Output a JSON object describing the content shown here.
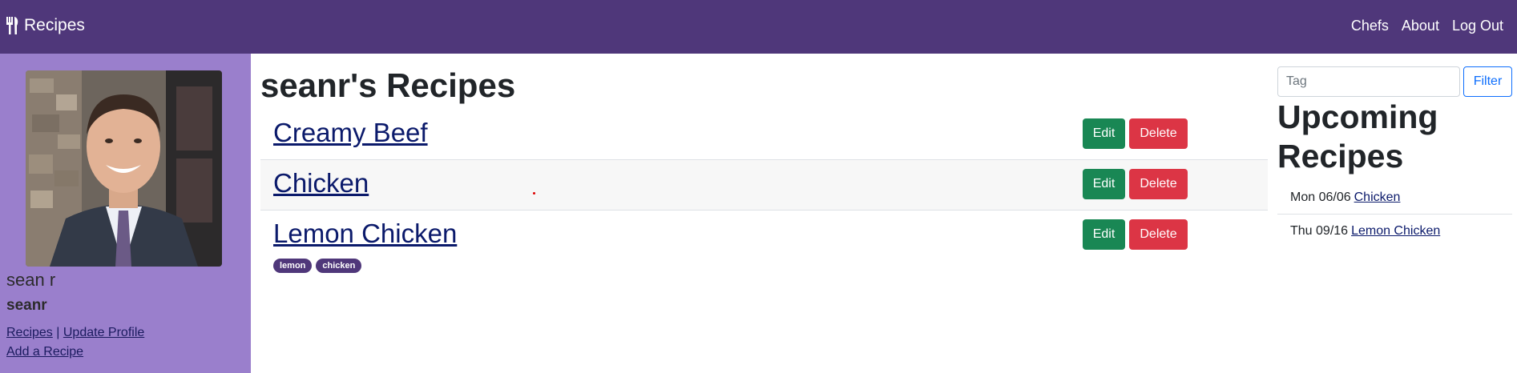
{
  "nav": {
    "brand": "Recipes",
    "links": [
      "Chefs",
      "About",
      "Log Out"
    ]
  },
  "profile": {
    "full_name": "sean r",
    "username": "seanr",
    "link_recipes": "Recipes",
    "separator": "|",
    "link_update_profile": "Update Profile",
    "link_add_recipe": "Add a Recipe"
  },
  "main": {
    "title": "seanr's Recipes",
    "recipes": [
      {
        "title": "Creamy Beef",
        "tags": []
      },
      {
        "title": "Chicken",
        "tags": []
      },
      {
        "title": "Lemon Chicken",
        "tags": [
          "lemon",
          "chicken"
        ]
      }
    ],
    "edit_label": "Edit",
    "delete_label": "Delete"
  },
  "sidebar_right": {
    "tag_placeholder": "Tag",
    "filter_label": "Filter",
    "upcoming_title": "Upcoming Recipes",
    "upcoming": [
      {
        "date": "Mon 06/06",
        "recipe": "Chicken"
      },
      {
        "date": "Thu 09/16",
        "recipe": "Lemon Chicken"
      }
    ]
  },
  "colors": {
    "navbar": "#4f377a",
    "sidebar": "#9a7fcc",
    "edit": "#198754",
    "delete": "#dc3545",
    "tag": "#4f377a"
  }
}
